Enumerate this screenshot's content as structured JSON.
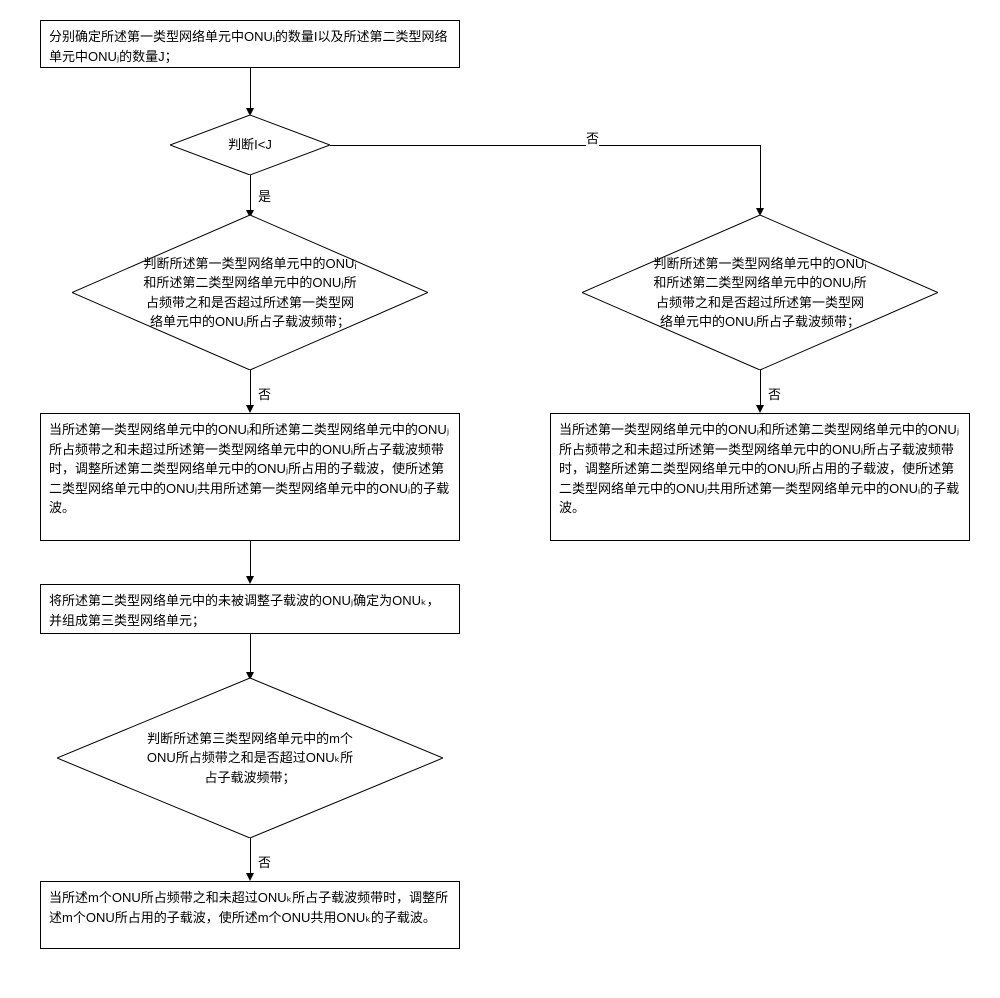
{
  "boxes": {
    "b1": "分别确定所述第一类型网络单元中ONUᵢ的数量I以及所述第二类型网络单元中ONUⱼ的数量J；",
    "d1": "判断I<J",
    "d2": "判断所述第一类型网络单元中的ONUᵢ和所述第二类型网络单元中的ONUⱼ所占频带之和是否超过所述第一类型网络单元中的ONUᵢ所占子载波频带；",
    "d2r": "判断所述第一类型网络单元中的ONUᵢ和所述第二类型网络单元中的ONUⱼ所占频带之和是否超过所述第一类型网络单元中的ONUᵢ所占子载波频带；",
    "b2": "当所述第一类型网络单元中的ONUᵢ和所述第二类型网络单元中的ONUⱼ所占频带之和未超过所述第一类型网络单元中的ONUᵢ所占子载波频带时，调整所述第二类型网络单元中的ONUⱼ所占用的子载波，使所述第二类型网络单元中的ONUⱼ共用所述第一类型网络单元中的ONUᵢ的子载波。",
    "b2r": "当所述第一类型网络单元中的ONUᵢ和所述第二类型网络单元中的ONUⱼ所占频带之和未超过所述第一类型网络单元中的ONUᵢ所占子载波频带时，调整所述第二类型网络单元中的ONUⱼ所占用的子载波，使所述第二类型网络单元中的ONUⱼ共用所述第一类型网络单元中的ONUᵢ的子载波。",
    "b3": "将所述第二类型网络单元中的未被调整子载波的ONUⱼ确定为ONUₖ，并组成第三类型网络单元；",
    "d3": "判断所述第三类型网络单元中的m个ONU所占频带之和是否超过ONUₖ所占子载波频带；",
    "b4": "当所述m个ONU所占频带之和未超过ONUₖ所占子载波频带时，调整所述m个ONU所占用的子载波，使所述m个ONU共用ONUₖ的子载波。"
  },
  "labels": {
    "yes": "是",
    "no": "否"
  }
}
